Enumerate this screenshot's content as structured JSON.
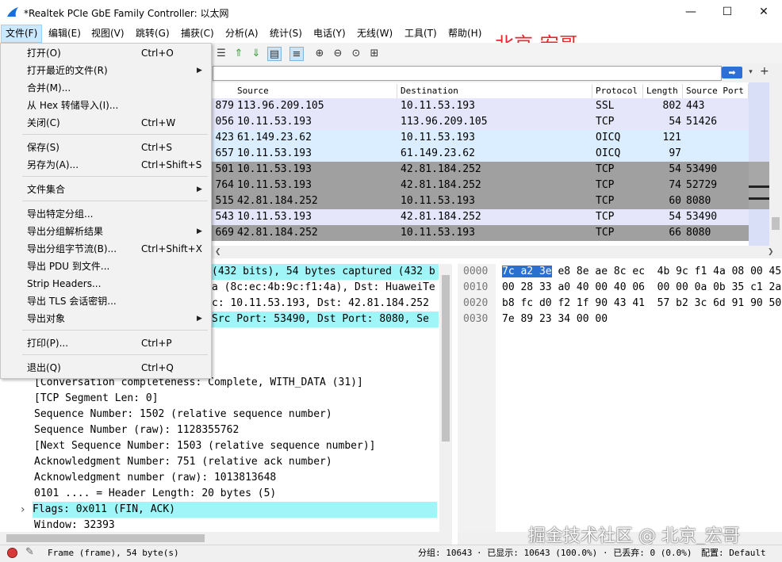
{
  "window": {
    "title": "*Realtek PCIe GbE Family Controller: 以太网",
    "controls": {
      "minimize": "—",
      "maximize": "☐",
      "close": "✕"
    }
  },
  "menubar": {
    "items": [
      "文件(F)",
      "编辑(E)",
      "视图(V)",
      "跳转(G)",
      "捕获(C)",
      "分析(A)",
      "统计(S)",
      "电话(Y)",
      "无线(W)",
      "工具(T)",
      "帮助(H)"
    ]
  },
  "watermark_top": "北京-宏哥",
  "watermark_bottom": "掘金技术社区 @ 北京_宏哥",
  "filter": {
    "apply_icon": "arrow-right-icon",
    "dropdown_icon": "▾",
    "add": "+"
  },
  "packet_list": {
    "columns": [
      "Source",
      "Destination",
      "Protocol",
      "Length",
      "Source Port"
    ],
    "rows": [
      {
        "no": "879",
        "src": "113.96.209.105",
        "dst": "10.11.53.193",
        "proto": "SSL",
        "len": "802",
        "sport": "443",
        "bg": "#e6e6fa"
      },
      {
        "no": "056",
        "src": "10.11.53.193",
        "dst": "113.96.209.105",
        "proto": "TCP",
        "len": "54",
        "sport": "51426",
        "bg": "#e6e6fa"
      },
      {
        "no": "423",
        "src": "61.149.23.62",
        "dst": "10.11.53.193",
        "proto": "OICQ",
        "len": "121",
        "sport": "",
        "bg": "#daeeff"
      },
      {
        "no": "657",
        "src": "10.11.53.193",
        "dst": "61.149.23.62",
        "proto": "OICQ",
        "len": "97",
        "sport": "",
        "bg": "#daeeff"
      },
      {
        "no": "501",
        "src": "10.11.53.193",
        "dst": "42.81.184.252",
        "proto": "TCP",
        "len": "54",
        "sport": "53490",
        "bg": "#a0a0a0"
      },
      {
        "no": "764",
        "src": "10.11.53.193",
        "dst": "42.81.184.252",
        "proto": "TCP",
        "len": "74",
        "sport": "52729",
        "bg": "#a0a0a0"
      },
      {
        "no": "515",
        "src": "42.81.184.252",
        "dst": "10.11.53.193",
        "proto": "TCP",
        "len": "60",
        "sport": "8080",
        "bg": "#a0a0a0"
      },
      {
        "no": "543",
        "src": "10.11.53.193",
        "dst": "42.81.184.252",
        "proto": "TCP",
        "len": "54",
        "sport": "53490",
        "bg": "#e6e6fa"
      },
      {
        "no": "669",
        "src": "42.81.184.252",
        "dst": "10.11.53.193",
        "proto": "TCP",
        "len": "66",
        "sport": "8080",
        "bg": "#a0a0a0"
      }
    ]
  },
  "details": {
    "lines": [
      {
        "text": "(432 bits), 54 bytes captured (432 b",
        "hl": true
      },
      {
        "text": "a (8c:ec:4b:9c:f1:4a), Dst: HuaweiTe",
        "hl": false
      },
      {
        "text": "c: 10.11.53.193, Dst: 42.81.184.252",
        "hl": false
      },
      {
        "text": " Src Port: 53490, Dst Port: 8080, Se",
        "hl": true
      },
      {
        "text": "[Conversation completeness: Complete, WITH_DATA (31)]",
        "hl": false
      },
      {
        "text": "[TCP Segment Len: 0]",
        "hl": false
      },
      {
        "text": "Sequence Number: 1502    (relative sequence number)",
        "hl": false
      },
      {
        "text": "Sequence Number (raw): 1128355762",
        "hl": false
      },
      {
        "text": "[Next Sequence Number: 1503    (relative sequence number)]",
        "hl": false
      },
      {
        "text": "Acknowledgment Number: 751    (relative ack number)",
        "hl": false
      },
      {
        "text": "Acknowledgment number (raw): 1013813648",
        "hl": false
      },
      {
        "text": "0101 .... = Header Length: 20 bytes (5)",
        "hl": false
      },
      {
        "text": "Flags: 0x011 (FIN, ACK)",
        "hl": true
      },
      {
        "text": "Window: 32393",
        "hl": false
      }
    ],
    "expander": "›"
  },
  "bytes": {
    "offsets": [
      "0000",
      "0010",
      "0020",
      "0030"
    ],
    "selected": "7c a2 3e",
    "row0_rest": " e8 8e ae 8c ec  4b 9c f1 4a 08 00 45",
    "rows": [
      "00 28 33 a0 40 00 40 06  00 00 0a 0b 35 c1 2a",
      "b8 fc d0 f2 1f 90 43 41  57 b2 3c 6d 91 90 50",
      "7e 89 23 34 00 00"
    ]
  },
  "statusbar": {
    "frame": "Frame (frame), 54 byte(s)",
    "packets": "分组: 10643",
    "displayed": "· 已显示: 10643 (100.0%)",
    "dropped": "· 已丢弃: 0 (0.0%)",
    "profile": "配置: Default"
  },
  "file_menu": {
    "items": [
      {
        "label": "打开(O)",
        "shortcut": "Ctrl+O",
        "submenu": false
      },
      {
        "label": "打开最近的文件(R)",
        "shortcut": "",
        "submenu": true
      },
      {
        "label": "合并(M)...",
        "shortcut": "",
        "submenu": false
      },
      {
        "label": "从 Hex 转储导入(I)...",
        "shortcut": "",
        "submenu": false
      },
      {
        "label": "关闭(C)",
        "shortcut": "Ctrl+W",
        "submenu": false
      },
      {
        "label": "保存(S)",
        "shortcut": "Ctrl+S",
        "submenu": false
      },
      {
        "label": "另存为(A)...",
        "shortcut": "Ctrl+Shift+S",
        "submenu": false
      },
      {
        "label": "文件集合",
        "shortcut": "",
        "submenu": true
      },
      {
        "label": "导出特定分组...",
        "shortcut": "",
        "submenu": false
      },
      {
        "label": "导出分组解析结果",
        "shortcut": "",
        "submenu": true
      },
      {
        "label": "导出分组字节流(B)...",
        "shortcut": "Ctrl+Shift+X",
        "submenu": false
      },
      {
        "label": "导出 PDU 到文件...",
        "shortcut": "",
        "submenu": false
      },
      {
        "label": "Strip Headers...",
        "shortcut": "",
        "submenu": false
      },
      {
        "label": "导出 TLS 会话密钥...",
        "shortcut": "",
        "submenu": false
      },
      {
        "label": "导出对象",
        "shortcut": "",
        "submenu": true
      },
      {
        "label": "打印(P)...",
        "shortcut": "Ctrl+P",
        "submenu": false
      },
      {
        "label": "退出(Q)",
        "shortcut": "Ctrl+Q",
        "submenu": false
      }
    ]
  },
  "colors": {
    "accent": "#2b6fd0",
    "highlight": "#9ff5f7",
    "watermark": "#e8262d"
  }
}
